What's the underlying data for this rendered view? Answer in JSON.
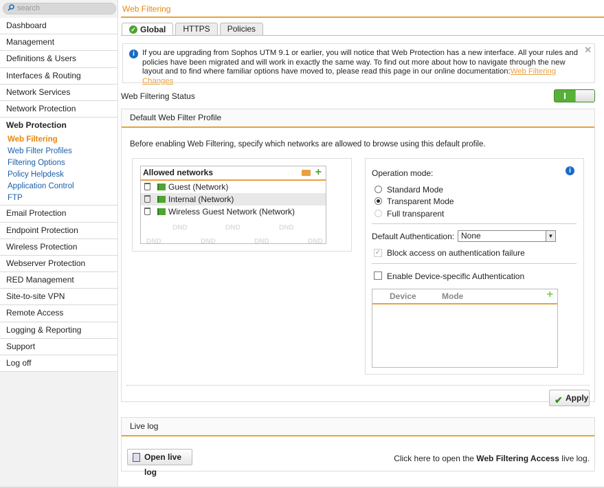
{
  "search": {
    "placeholder": "search"
  },
  "nav": {
    "items_top": [
      "Dashboard",
      "Management",
      "Definitions & Users",
      "Interfaces & Routing",
      "Network Services",
      "Network Protection"
    ],
    "open_section": "Web Protection",
    "sub_items": [
      "Web Filtering",
      "Web Filter Profiles",
      "Filtering Options",
      "Policy Helpdesk",
      "Application Control",
      "FTP"
    ],
    "items_bottom": [
      "Email Protection",
      "Endpoint Protection",
      "Wireless Protection",
      "Webserver Protection",
      "RED Management",
      "Site-to-site VPN",
      "Remote Access",
      "Logging & Reporting",
      "Support",
      "Log off"
    ]
  },
  "page": {
    "title": "Web Filtering"
  },
  "tabs": [
    "Global",
    "HTTPS",
    "Policies"
  ],
  "info": {
    "text": "If you are upgrading from Sophos UTM 9.1 or earlier, you will notice that Web Protection has a new interface. All your rules and policies have been migrated and will work in exactly the same way. To find out more about how to navigate through the new layout and to find where familiar options have moved to, please read this page in our online documentation:",
    "link": "Web Filtering Changes",
    "close": "✕"
  },
  "status": {
    "label": "Web Filtering Status",
    "enabled": true,
    "toggle_mark": "I"
  },
  "profile": {
    "header": "Default Web Filter Profile",
    "hint": "Before enabling Web Filtering, specify which networks are allowed to browse using this default profile.",
    "allowed": {
      "title": "Allowed networks",
      "rows": [
        "Guest (Network)",
        "Internal (Network)",
        "Wireless Guest Network (Network)"
      ],
      "dnd": "DND"
    },
    "operation_label": "Operation mode:",
    "modes": [
      "Standard Mode",
      "Transparent Mode",
      "Full transparent"
    ],
    "selected_mode": "Transparent Mode",
    "auth_label": "Default Authentication:",
    "auth_value": "None",
    "block_label": "Block access on authentication failure",
    "device_auth_label": "Enable Device-specific Authentication",
    "device_cols": [
      "Device",
      "Mode"
    ],
    "apply": "Apply"
  },
  "livelog": {
    "header": "Live log",
    "button": "Open live log",
    "text_pre": "Click here to open the ",
    "text_bold": "Web Filtering Access",
    "text_post": " live log."
  },
  "colors": {
    "accent": "#e8860c",
    "link": "#1a5fa8",
    "ok": "#4ca62f"
  }
}
